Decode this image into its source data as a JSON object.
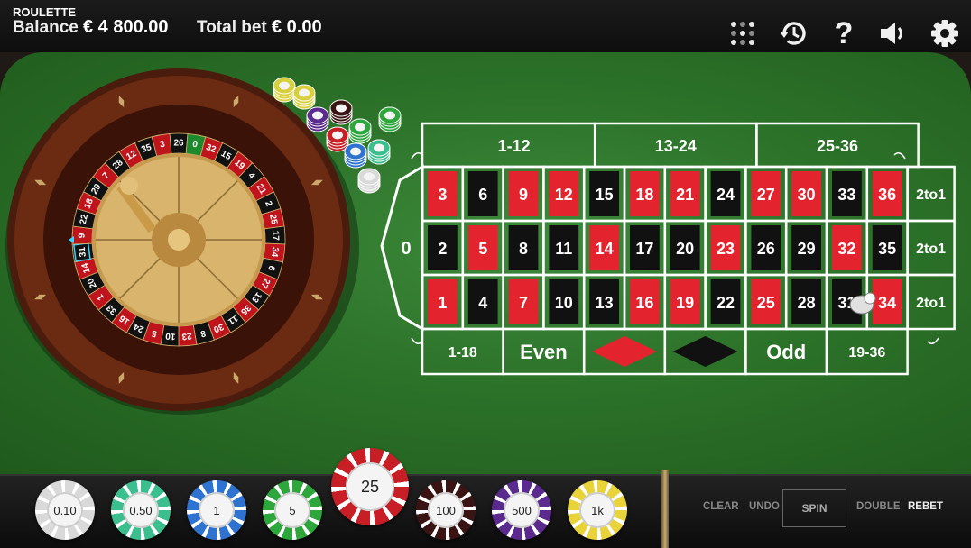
{
  "header": {
    "title": "ROULETTE",
    "balance_label": "Balance",
    "balance_value": "€ 4 800.00",
    "total_bet_label": "Total bet",
    "total_bet_value": "€ 0.00"
  },
  "toolbar_icons": [
    "grid-menu-icon",
    "history-icon",
    "help-icon",
    "sound-icon",
    "settings-icon"
  ],
  "help_glyph": "?",
  "wheel": {
    "numbers_visible": [
      "26",
      "0",
      "32",
      "15",
      "19",
      "4",
      "21",
      "2",
      "25",
      "17",
      "34",
      "6",
      "27",
      "13",
      "36",
      "11",
      "30",
      "8",
      "23",
      "10",
      "5",
      "24",
      "16",
      "33",
      "1",
      "20",
      "14",
      "31",
      "9",
      "22",
      "18",
      "29",
      "7",
      "28",
      "12",
      "35",
      "3"
    ],
    "highlighted_number": "31"
  },
  "board": {
    "zero": "0",
    "dozens": [
      "1-12",
      "13-24",
      "25-36"
    ],
    "rows": [
      [
        "3",
        "6",
        "9",
        "12",
        "15",
        "18",
        "21",
        "24",
        "27",
        "30",
        "33",
        "36"
      ],
      [
        "2",
        "5",
        "8",
        "11",
        "14",
        "17",
        "20",
        "23",
        "26",
        "29",
        "32",
        "35"
      ],
      [
        "1",
        "4",
        "7",
        "10",
        "13",
        "16",
        "19",
        "22",
        "25",
        "28",
        "31",
        "34"
      ]
    ],
    "column_bets": [
      "2to1",
      "2to1",
      "2to1"
    ],
    "outside": [
      "1-18",
      "Even",
      "red",
      "black",
      "Odd",
      "19-36"
    ],
    "red_numbers": [
      "1",
      "3",
      "5",
      "7",
      "9",
      "12",
      "14",
      "16",
      "18",
      "19",
      "21",
      "23",
      "25",
      "27",
      "30",
      "32",
      "34",
      "36"
    ]
  },
  "colors": {
    "red": "#e3242f",
    "black": "#111111",
    "felt": "#2c7229",
    "line": "#ffffff"
  },
  "chips": [
    {
      "label": "0.10",
      "color": "#d9d9d9"
    },
    {
      "label": "0.50",
      "color": "#3bbf8f"
    },
    {
      "label": "1",
      "color": "#2f73d0"
    },
    {
      "label": "5",
      "color": "#2da63b"
    },
    {
      "label": "25",
      "color": "#c81e25",
      "selected": true
    },
    {
      "label": "100",
      "color": "#3a1412"
    },
    {
      "label": "500",
      "color": "#5b2a8e"
    },
    {
      "label": "1k",
      "color": "#e8d33a"
    }
  ],
  "actions": {
    "clear": "CLEAR",
    "undo": "UNDO",
    "spin": "SPIN",
    "double": "DOUBLE",
    "rebet": "REBET"
  }
}
